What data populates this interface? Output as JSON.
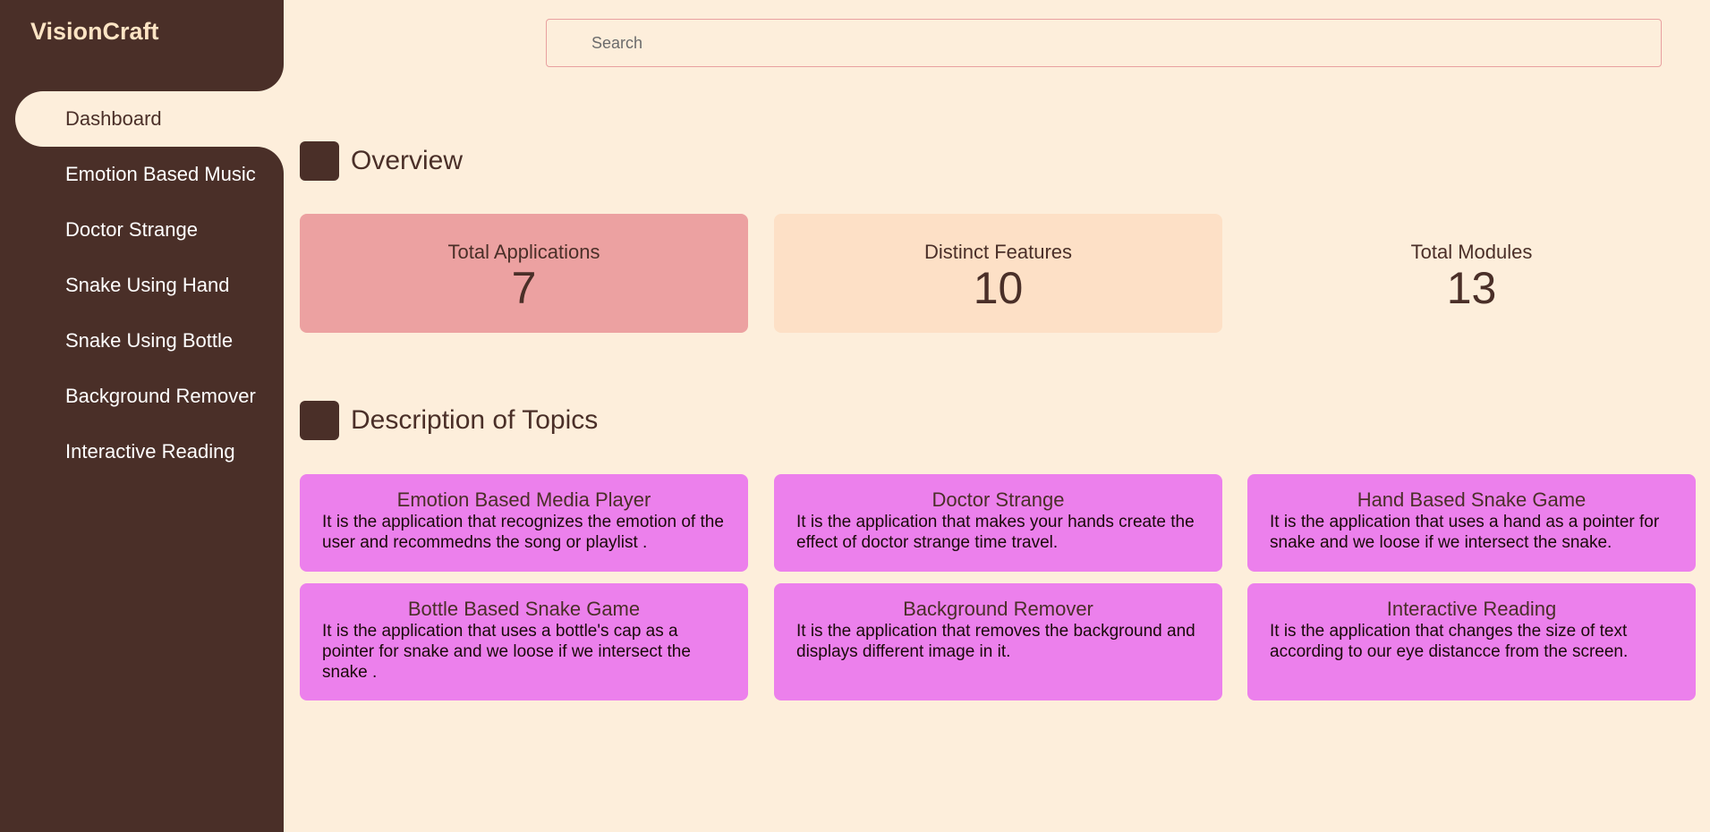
{
  "app": {
    "name": "VisionCraft"
  },
  "sidebar": {
    "items": [
      {
        "label": "Dashboard",
        "active": true
      },
      {
        "label": "Emotion Based Music"
      },
      {
        "label": "Doctor Strange"
      },
      {
        "label": "Snake Using Hand"
      },
      {
        "label": "Snake Using Bottle"
      },
      {
        "label": "Background Remover"
      },
      {
        "label": "Interactive Reading"
      }
    ]
  },
  "search": {
    "placeholder": "Search",
    "value": ""
  },
  "overview": {
    "title": "Overview",
    "stats": [
      {
        "label": "Total Applications",
        "value": "7",
        "color": "#eca1a1"
      },
      {
        "label": "Distinct Features",
        "value": "10",
        "color": "#fde0c6"
      },
      {
        "label": "Total Modules",
        "value": "13",
        "color": "#fdeedb"
      }
    ]
  },
  "topics": {
    "title": "Description of Topics",
    "items": [
      {
        "title": "Emotion Based Media Player",
        "description": "It is the application that recognizes the emotion of the user and recommedns the song or playlist ."
      },
      {
        "title": "Doctor Strange",
        "description": "It is the application that makes your hands create the effect of doctor strange time travel."
      },
      {
        "title": "Hand Based Snake Game",
        "description": "It is the application that uses a hand as a pointer for snake and we loose if we intersect the snake."
      },
      {
        "title": "Bottle Based Snake Game",
        "description": "It is the application that uses a bottle's cap as a pointer for snake and we loose if we intersect the snake ."
      },
      {
        "title": "Background Remover",
        "description": "It is the application that removes the background and displays different image in it."
      },
      {
        "title": "Interactive Reading",
        "description": "It is the application that changes the size of text according to our eye distancce from the screen."
      }
    ]
  },
  "colors": {
    "sidebar": "#4a2f28",
    "background": "#fdeedb",
    "card_pink": "#ec80ec",
    "logo": "#fde4c4"
  }
}
